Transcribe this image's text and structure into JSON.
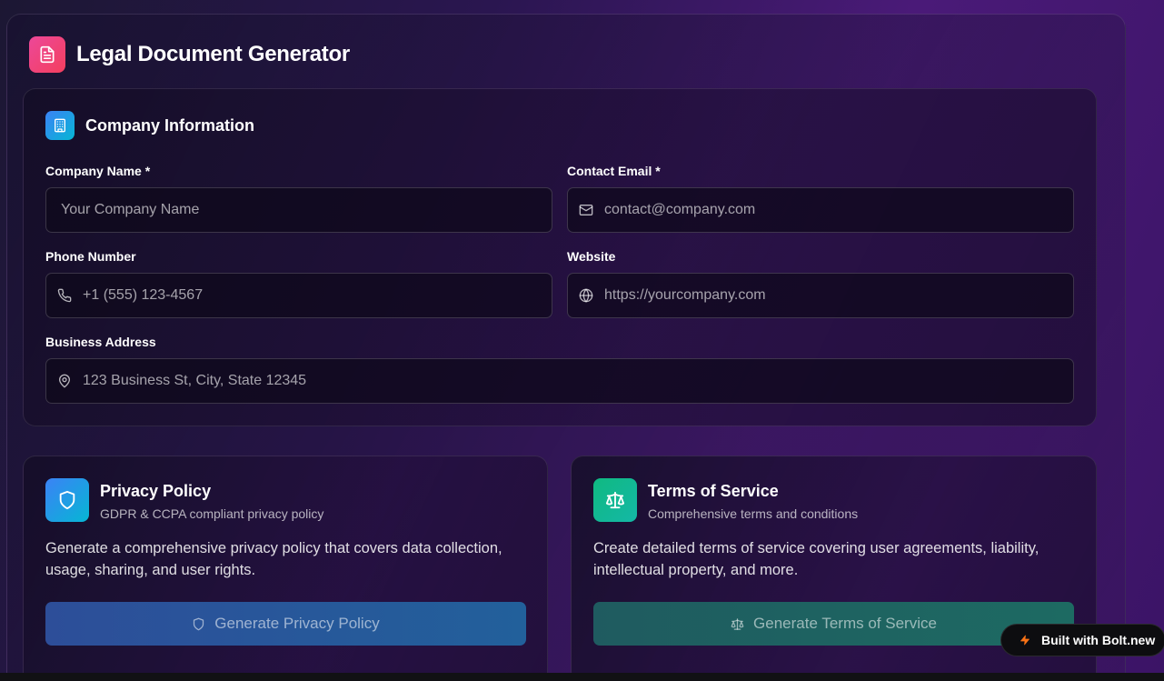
{
  "header": {
    "title": "Legal Document Generator",
    "icon": "file-text-icon"
  },
  "company_section": {
    "title": "Company Information",
    "icon": "building-icon",
    "fields": {
      "company_name": {
        "label": "Company Name *",
        "placeholder": "Your Company Name",
        "value": ""
      },
      "contact_email": {
        "label": "Contact Email *",
        "placeholder": "contact@company.com",
        "value": "",
        "icon": "mail-icon"
      },
      "phone": {
        "label": "Phone Number",
        "placeholder": "+1 (555) 123-4567",
        "value": "",
        "icon": "phone-icon"
      },
      "website": {
        "label": "Website",
        "placeholder": "https://yourcompany.com",
        "value": "",
        "icon": "globe-icon"
      },
      "address": {
        "label": "Business Address",
        "placeholder": "123 Business St, City, State 12345",
        "value": "",
        "icon": "map-pin-icon"
      }
    }
  },
  "privacy": {
    "title": "Privacy Policy",
    "subtitle": "GDPR & CCPA compliant privacy policy",
    "description": "Generate a comprehensive privacy policy that covers data collection, usage, sharing, and user rights.",
    "button_label": "Generate Privacy Policy",
    "icon": "shield-icon"
  },
  "terms": {
    "title": "Terms of Service",
    "subtitle": "Comprehensive terms and conditions",
    "description": "Create detailed terms of service covering user agreements, liability, intellectual property, and more.",
    "button_label": "Generate Terms of Service",
    "icon": "scale-icon"
  },
  "badge": {
    "label": "Built with Bolt.new",
    "icon": "zap-icon"
  },
  "colors": {
    "privacy_accent": "#3b82f6",
    "terms_accent": "#10b981",
    "header_accent": "#ec4899",
    "badge_zap": "#f97316"
  }
}
